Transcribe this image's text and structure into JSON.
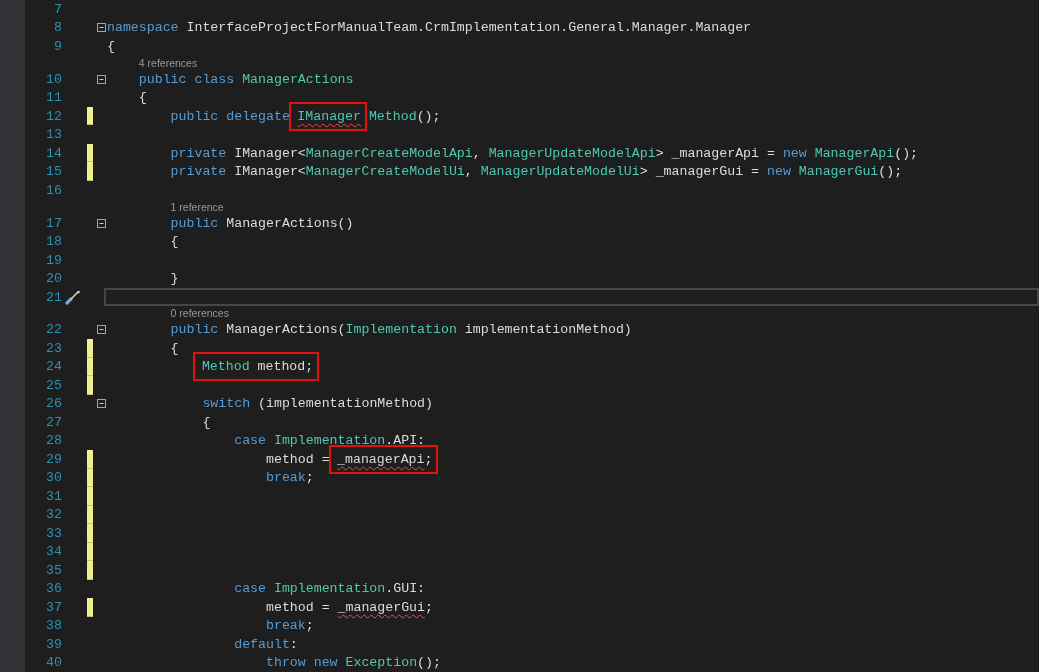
{
  "editor": {
    "lines": [
      {
        "number": "7",
        "changed": false,
        "current": false
      },
      {
        "number": "8",
        "changed": false,
        "current": false,
        "fold": {
          "expanded": true
        },
        "tokens": [
          {
            "kind": "keyword",
            "text": "namespace"
          },
          {
            "kind": "plain",
            "text": " InterfaceProjectForManualTeam.CrmImplementation.General.Manager.Manager"
          }
        ]
      },
      {
        "number": "9",
        "changed": false,
        "current": false,
        "tokens": [
          {
            "kind": "plain",
            "text": "{"
          }
        ]
      },
      {
        "number": "10",
        "changed": false,
        "current": false,
        "lens": "4 references",
        "fold": {
          "expanded": true
        },
        "tokens": [
          {
            "kind": "keyword",
            "text": "    public class"
          },
          {
            "kind": "type",
            "text": " ManagerActions"
          }
        ]
      },
      {
        "number": "11",
        "changed": false,
        "current": false,
        "tokens": [
          {
            "kind": "plain",
            "text": "    {"
          }
        ]
      },
      {
        "number": "12",
        "changed": true,
        "current": false,
        "tokens": [
          {
            "kind": "keyword",
            "text": "        public delegate "
          },
          {
            "kind": "type",
            "text": "IManager",
            "boxed": true,
            "error": true
          },
          {
            "kind": "type",
            "text": " Method"
          },
          {
            "kind": "plain",
            "text": "();"
          }
        ]
      },
      {
        "number": "13",
        "changed": false,
        "current": false
      },
      {
        "number": "14",
        "changed": true,
        "current": false,
        "tokens": [
          {
            "kind": "keyword",
            "text": "        private "
          },
          {
            "kind": "plain",
            "text": "IManager<"
          },
          {
            "kind": "type",
            "text": "ManagerCreateModelApi"
          },
          {
            "kind": "plain",
            "text": ", "
          },
          {
            "kind": "type",
            "text": "ManagerUpdateModelApi"
          },
          {
            "kind": "plain",
            "text": "> _managerApi = "
          },
          {
            "kind": "keyword",
            "text": "new "
          },
          {
            "kind": "type",
            "text": "ManagerApi"
          },
          {
            "kind": "plain",
            "text": "();"
          }
        ]
      },
      {
        "number": "15",
        "changed": true,
        "current": false,
        "tokens": [
          {
            "kind": "keyword",
            "text": "        private "
          },
          {
            "kind": "plain",
            "text": "IManager<"
          },
          {
            "kind": "type",
            "text": "ManagerCreateModelUi"
          },
          {
            "kind": "plain",
            "text": ", "
          },
          {
            "kind": "type",
            "text": "ManagerUpdateModelUi"
          },
          {
            "kind": "plain",
            "text": "> _managerGui = "
          },
          {
            "kind": "keyword",
            "text": "new "
          },
          {
            "kind": "type",
            "text": "ManagerGui"
          },
          {
            "kind": "plain",
            "text": "();"
          }
        ]
      },
      {
        "number": "16",
        "changed": false,
        "current": false
      },
      {
        "number": "17",
        "changed": false,
        "current": false,
        "lens": "1 reference",
        "fold": {
          "expanded": true
        },
        "tokens": [
          {
            "kind": "keyword",
            "text": "        public "
          },
          {
            "kind": "plain",
            "text": "ManagerActions()"
          }
        ]
      },
      {
        "number": "18",
        "changed": false,
        "current": false,
        "tokens": [
          {
            "kind": "plain",
            "text": "        {"
          }
        ]
      },
      {
        "number": "19",
        "changed": false,
        "current": false
      },
      {
        "number": "20",
        "changed": false,
        "current": false,
        "tokens": [
          {
            "kind": "plain",
            "text": "        }"
          }
        ]
      },
      {
        "number": "21",
        "changed": false,
        "current": true,
        "quick_actions": true
      },
      {
        "number": "22",
        "changed": false,
        "current": false,
        "lens": "0 references",
        "fold": {
          "expanded": true
        },
        "tokens": [
          {
            "kind": "keyword",
            "text": "        public "
          },
          {
            "kind": "plain",
            "text": "ManagerActions("
          },
          {
            "kind": "type",
            "text": "Implementation"
          },
          {
            "kind": "plain",
            "text": " implementationMethod)"
          }
        ]
      },
      {
        "number": "23",
        "changed": true,
        "current": false,
        "tokens": [
          {
            "kind": "plain",
            "text": "        {"
          }
        ]
      },
      {
        "number": "24",
        "changed": true,
        "current": false,
        "tokens": [
          {
            "kind": "type",
            "text": "            Method",
            "boxed": true
          },
          {
            "kind": "plain",
            "text": " method;",
            "boxed": true
          }
        ]
      },
      {
        "number": "25",
        "changed": true,
        "current": false
      },
      {
        "number": "26",
        "changed": false,
        "current": false,
        "fold": {
          "expanded": true
        },
        "tokens": [
          {
            "kind": "keyword",
            "text": "            switch"
          },
          {
            "kind": "plain",
            "text": " (implementationMethod)"
          }
        ]
      },
      {
        "number": "27",
        "changed": false,
        "current": false,
        "tokens": [
          {
            "kind": "plain",
            "text": "            {"
          }
        ]
      },
      {
        "number": "28",
        "changed": false,
        "current": false,
        "tokens": [
          {
            "kind": "keyword",
            "text": "                case "
          },
          {
            "kind": "type",
            "text": "Implementation"
          },
          {
            "kind": "plain",
            "text": ".API:"
          }
        ]
      },
      {
        "number": "29",
        "changed": true,
        "current": false,
        "tokens": [
          {
            "kind": "plain",
            "text": "                    method = "
          },
          {
            "kind": "plain",
            "text": "_managerApi",
            "boxed": true,
            "error": true
          },
          {
            "kind": "plain",
            "text": ";",
            "boxed": true
          }
        ]
      },
      {
        "number": "30",
        "changed": true,
        "current": false,
        "tokens": [
          {
            "kind": "keyword",
            "text": "                    break"
          },
          {
            "kind": "plain",
            "text": ";"
          }
        ]
      },
      {
        "number": "31",
        "changed": true,
        "current": false
      },
      {
        "number": "32",
        "changed": true,
        "current": false
      },
      {
        "number": "33",
        "changed": true,
        "current": false
      },
      {
        "number": "34",
        "changed": true,
        "current": false
      },
      {
        "number": "35",
        "changed": true,
        "current": false
      },
      {
        "number": "36",
        "changed": false,
        "current": false,
        "tokens": [
          {
            "kind": "keyword",
            "text": "                case "
          },
          {
            "kind": "type",
            "text": "Implementation"
          },
          {
            "kind": "plain",
            "text": ".GUI:"
          }
        ]
      },
      {
        "number": "37",
        "changed": true,
        "current": false,
        "tokens": [
          {
            "kind": "plain",
            "text": "                    method = "
          },
          {
            "kind": "plain",
            "text": "_managerGui",
            "error": true
          },
          {
            "kind": "plain",
            "text": ";"
          }
        ]
      },
      {
        "number": "38",
        "changed": false,
        "current": false,
        "tokens": [
          {
            "kind": "keyword",
            "text": "                    break"
          },
          {
            "kind": "plain",
            "text": ";"
          }
        ]
      },
      {
        "number": "39",
        "changed": false,
        "current": false,
        "tokens": [
          {
            "kind": "keyword",
            "text": "                default"
          },
          {
            "kind": "plain",
            "text": ":"
          }
        ]
      },
      {
        "number": "40",
        "changed": false,
        "current": false,
        "tokens": [
          {
            "kind": "keyword",
            "text": "                    throw new "
          },
          {
            "kind": "type",
            "text": "Exception"
          },
          {
            "kind": "plain",
            "text": "();"
          }
        ]
      }
    ]
  }
}
